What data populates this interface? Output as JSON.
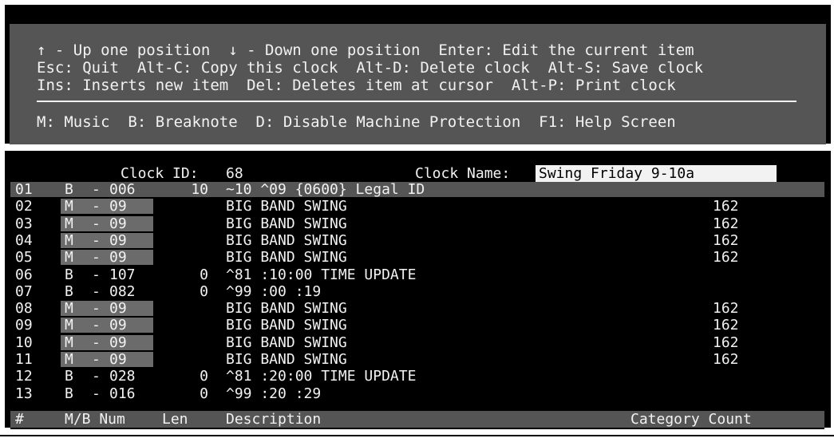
{
  "help": {
    "line1": "↑ - Up one position  ↓ - Down one position  Enter: Edit the current item",
    "line2": "Esc: Quit  Alt-C: Copy this clock  Alt-D: Delete clock  Alt-S: Save clock",
    "line3": "Ins: Inserts new item  Del: Deletes item at cursor  Alt-P: Print clock",
    "line4": "M: Music  B: Breaknote  D: Disable Machine Protection  F1: Help Screen"
  },
  "clock": {
    "id_label": "Clock ID:",
    "id_value": "68",
    "name_label": "Clock Name:",
    "name_value": "Swing Friday 9-10a"
  },
  "rows": [
    {
      "num": "01",
      "mb": "B",
      "code": "006",
      "len": "10",
      "desc": "~10 ^09 {0600} Legal ID",
      "count": ""
    },
    {
      "num": "02",
      "mb": "M",
      "code": "09",
      "len": "",
      "desc": "BIG BAND SWING",
      "count": "162"
    },
    {
      "num": "03",
      "mb": "M",
      "code": "09",
      "len": "",
      "desc": "BIG BAND SWING",
      "count": "162"
    },
    {
      "num": "04",
      "mb": "M",
      "code": "09",
      "len": "",
      "desc": "BIG BAND SWING",
      "count": "162"
    },
    {
      "num": "05",
      "mb": "M",
      "code": "09",
      "len": "",
      "desc": "BIG BAND SWING",
      "count": "162"
    },
    {
      "num": "06",
      "mb": "B",
      "code": "107",
      "len": "0",
      "desc": "^81 :10:00 TIME UPDATE",
      "count": ""
    },
    {
      "num": "07",
      "mb": "B",
      "code": "082",
      "len": "0",
      "desc": "^99 :00 :19",
      "count": ""
    },
    {
      "num": "08",
      "mb": "M",
      "code": "09",
      "len": "",
      "desc": "BIG BAND SWING",
      "count": "162"
    },
    {
      "num": "09",
      "mb": "M",
      "code": "09",
      "len": "",
      "desc": "BIG BAND SWING",
      "count": "162"
    },
    {
      "num": "10",
      "mb": "M",
      "code": "09",
      "len": "",
      "desc": "BIG BAND SWING",
      "count": "162"
    },
    {
      "num": "11",
      "mb": "M",
      "code": "09",
      "len": "",
      "desc": "BIG BAND SWING",
      "count": "162"
    },
    {
      "num": "12",
      "mb": "B",
      "code": "028",
      "len": "0",
      "desc": "^81 :20:00 TIME UPDATE",
      "count": ""
    },
    {
      "num": "13",
      "mb": "B",
      "code": "016",
      "len": "0",
      "desc": "^99 :20 :29",
      "count": ""
    }
  ],
  "columns": {
    "num": "#",
    "mb_num": "M/B Num",
    "len": "Len",
    "desc": "Description",
    "cat_count": "Category Count"
  }
}
